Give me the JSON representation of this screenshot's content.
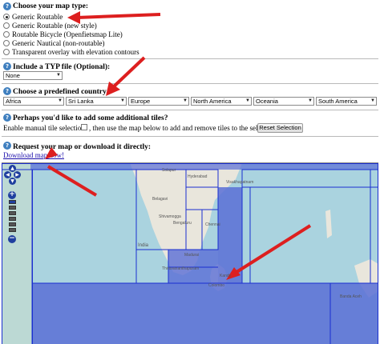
{
  "map_type": {
    "heading": "Choose your map type:",
    "options": [
      {
        "label": "Generic Routable",
        "checked": true
      },
      {
        "label": "Generic Routable (new style)",
        "checked": false
      },
      {
        "label": "Routable Bicycle (Openfietsmap Lite)",
        "checked": false
      },
      {
        "label": "Generic Nautical (non-routable)",
        "checked": false
      },
      {
        "label": "Transparent overlay with elevation contours",
        "checked": false
      }
    ]
  },
  "typ_file": {
    "heading": "Include a TYP file (Optional):",
    "selected": "None"
  },
  "country": {
    "heading": "Choose a predefined country:",
    "selects": [
      "Africa",
      "Sri Lanka",
      "Europe",
      "North America",
      "Oceania",
      "South America"
    ]
  },
  "tiles": {
    "heading": "Perhaps you'd like to add some additional tiles?",
    "manual_label": "Enable manual tile selection:",
    "manual_suffix": ", then use the map below to add and remove tiles to the selection.",
    "reset_label": "Reset Selection"
  },
  "download": {
    "heading": "Request your map or download it directly:",
    "link": "Download map now!"
  },
  "map": {
    "labels": [
      "Solapur",
      "Hyderabad",
      "Visakhapatnam",
      "Belagavi",
      "Bengaluru",
      "Chennai",
      "Shivamogga",
      "India",
      "Madurai",
      "Thiruvananthapuram",
      "Kandy",
      "Colombo",
      "Banda Aceh"
    ],
    "zoom_levels": 6,
    "active_zoom_level": 0
  },
  "icons": {
    "help": "help-question-icon",
    "zoom_in": "zoom-in-icon",
    "zoom_out": "zoom-out-icon",
    "pan": "pan-arrow-icon"
  },
  "colors": {
    "selected_tile": "#5a6ed6",
    "tile_border": "#1a2fd0",
    "ocean": "#aad3df",
    "land": "#e9e6dc",
    "annotation_arrow": "#dd1f1f",
    "link": "#1a0dab"
  }
}
